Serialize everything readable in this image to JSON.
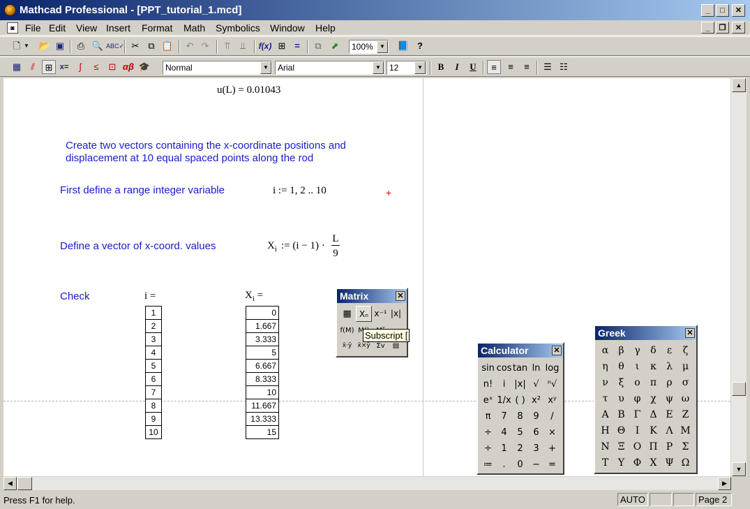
{
  "window": {
    "title": "Mathcad Professional - [PPT_tutorial_1.mcd]"
  },
  "menus": [
    "File",
    "Edit",
    "View",
    "Insert",
    "Format",
    "Math",
    "Symbolics",
    "Window",
    "Help"
  ],
  "toolbar": {
    "zoom": "100%"
  },
  "format_bar": {
    "style": "Normal",
    "font": "Arial",
    "size": "12",
    "bold": "B",
    "italic": "I",
    "underline": "U"
  },
  "worksheet": {
    "result_lhs": "u(L)",
    "result_rhs": "= 0.01043",
    "intro_line1": "Create two vectors containing the x-coordinate positions and",
    "intro_line2": "displacement at 10 equal spaced points along the rod",
    "range_text": "First define a range integer variable",
    "range_expr": "i := 1, 2 .. 10",
    "vector_text": "Define a vector of x-coord. values",
    "vector_lhs": "X",
    "vector_sub": "i",
    "vector_mid": ":= (i − 1) ·",
    "vector_num": "L",
    "vector_den": "9",
    "check_text": "Check",
    "i_label": "i =",
    "x_label": "X",
    "x_sub": "i",
    "x_eq": "=",
    "i_values": [
      "1",
      "2",
      "3",
      "4",
      "5",
      "6",
      "7",
      "8",
      "9",
      "10"
    ],
    "x_values": [
      "0",
      "1.667",
      "3.333",
      "5",
      "6.667",
      "8.333",
      "10",
      "11.667",
      "13.333",
      "15"
    ],
    "crosshair": "+"
  },
  "matrix_palette": {
    "title": "Matrix",
    "tooltip": "Subscript ["
  },
  "calculator": {
    "title": "Calculator",
    "keys": [
      [
        "sin",
        "cos",
        "tan",
        "ln",
        "log"
      ],
      [
        "n!",
        "i",
        "|x|",
        "√",
        "ⁿ√"
      ],
      [
        "eˣ",
        "1/x",
        "( )",
        "x²",
        "xʸ"
      ],
      [
        "π",
        "7",
        "8",
        "9",
        "/"
      ],
      [
        "÷",
        "4",
        "5",
        "6",
        "×"
      ],
      [
        "÷",
        "1",
        "2",
        "3",
        "+"
      ],
      [
        "≔",
        ".",
        "0",
        "−",
        "="
      ]
    ]
  },
  "greek": {
    "title": "Greek",
    "keys": [
      [
        "α",
        "β",
        "γ",
        "δ",
        "ε",
        "ζ"
      ],
      [
        "η",
        "θ",
        "ι",
        "κ",
        "λ",
        "μ"
      ],
      [
        "ν",
        "ξ",
        "ο",
        "π",
        "ρ",
        "σ"
      ],
      [
        "τ",
        "υ",
        "φ",
        "χ",
        "ψ",
        "ω"
      ],
      [
        "Α",
        "Β",
        "Γ",
        "Δ",
        "Ε",
        "Ζ"
      ],
      [
        "Η",
        "Θ",
        "Ι",
        "Κ",
        "Λ",
        "Μ"
      ],
      [
        "Ν",
        "Ξ",
        "Ο",
        "Π",
        "Ρ",
        "Σ"
      ],
      [
        "Τ",
        "Υ",
        "Φ",
        "Χ",
        "Ψ",
        "Ω"
      ]
    ]
  },
  "status": {
    "help": "Press F1 for help.",
    "mode": "AUTO",
    "page": "Page 2"
  }
}
